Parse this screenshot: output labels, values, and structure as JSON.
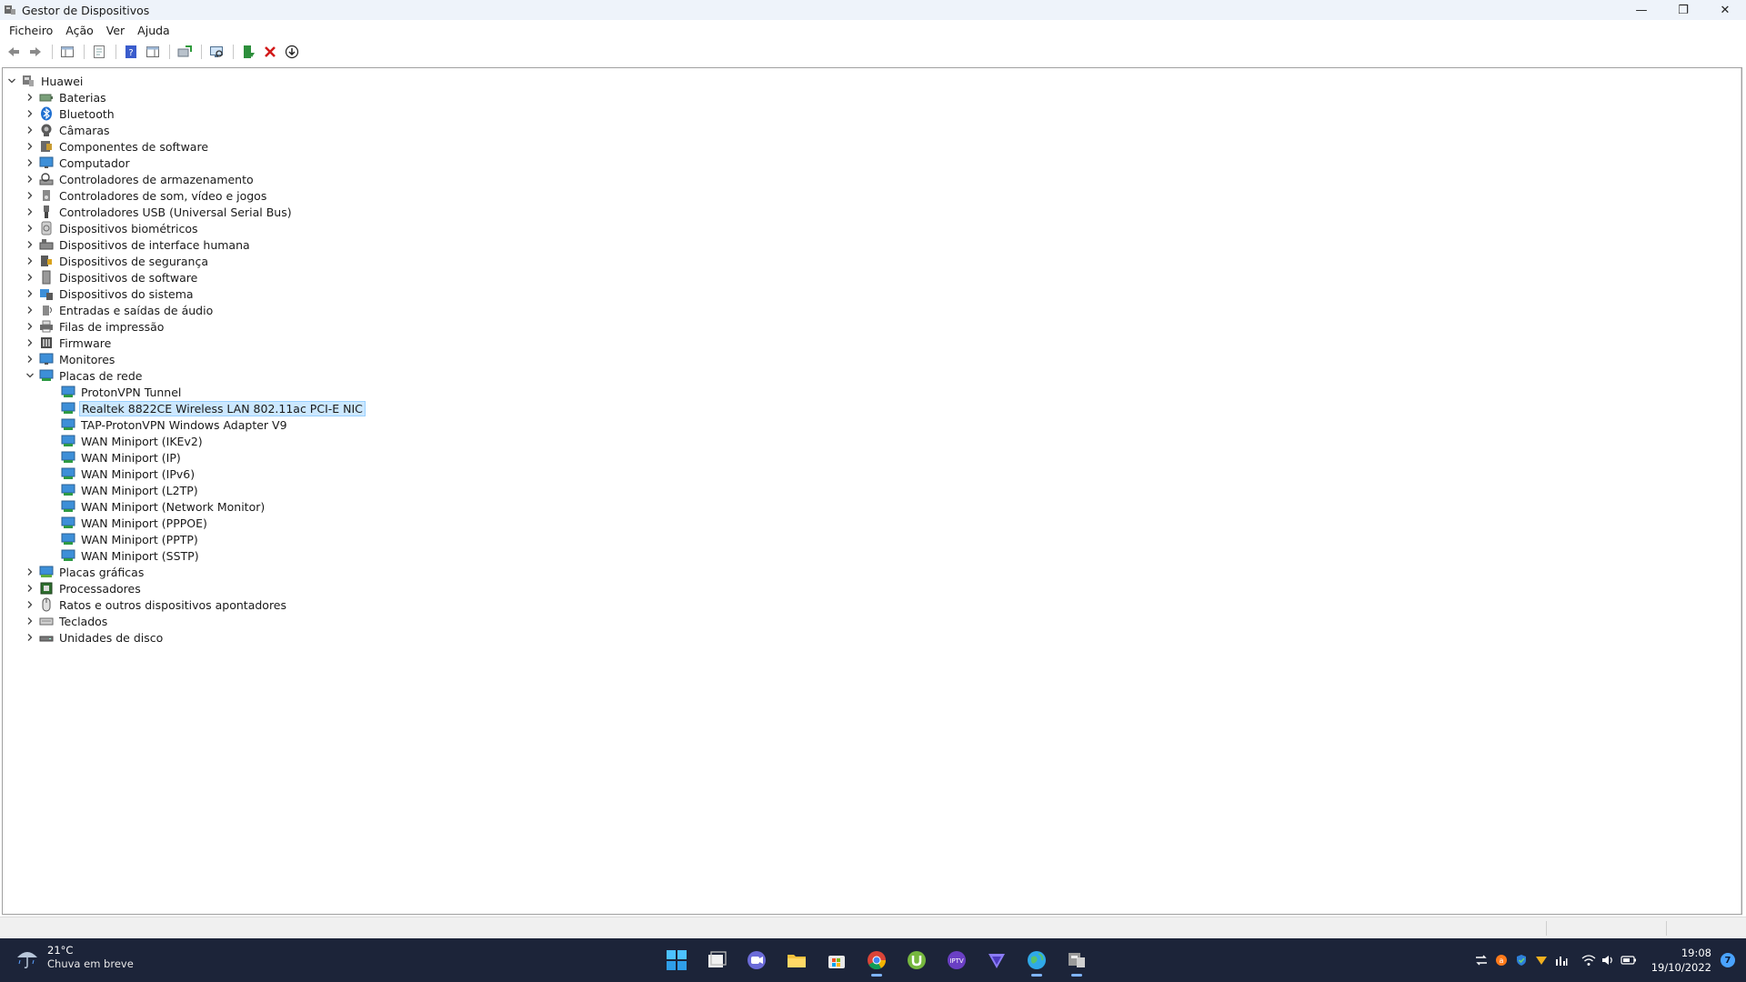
{
  "window": {
    "title": "Gestor de Dispositivos",
    "controls": {
      "minimize": "—",
      "restore": "❐",
      "close": "✕"
    }
  },
  "menu": [
    "Ficheiro",
    "Ação",
    "Ver",
    "Ajuda"
  ],
  "toolbar_icons": [
    "back-arrow-icon",
    "forward-arrow-icon",
    "show-hide-console-tree-icon",
    "properties-icon",
    "help-icon",
    "action-pane-icon",
    "update-driver-icon",
    "scan-hardware-icon",
    "enable-device-icon",
    "uninstall-device-icon",
    "download-driver-icon"
  ],
  "tree": {
    "root": {
      "label": "Huawei",
      "icon": "computer-icon"
    },
    "categories": [
      {
        "label": "Baterias",
        "icon": "battery-icon"
      },
      {
        "label": "Bluetooth",
        "icon": "bluetooth-icon"
      },
      {
        "label": "Câmaras",
        "icon": "camera-icon"
      },
      {
        "label": "Componentes de software",
        "icon": "software-component-icon"
      },
      {
        "label": "Computador",
        "icon": "monitor-icon"
      },
      {
        "label": "Controladores de armazenamento",
        "icon": "storage-controller-icon"
      },
      {
        "label": "Controladores de som, vídeo e jogos",
        "icon": "speaker-icon"
      },
      {
        "label": "Controladores USB (Universal Serial Bus)",
        "icon": "usb-icon"
      },
      {
        "label": "Dispositivos biométricos",
        "icon": "fingerprint-icon"
      },
      {
        "label": "Dispositivos de interface humana",
        "icon": "hid-icon"
      },
      {
        "label": "Dispositivos de segurança",
        "icon": "security-key-icon"
      },
      {
        "label": "Dispositivos de software",
        "icon": "software-device-icon"
      },
      {
        "label": "Dispositivos do sistema",
        "icon": "system-folder-icon"
      },
      {
        "label": "Entradas e saídas de áudio",
        "icon": "audio-io-icon"
      },
      {
        "label": "Filas de impressão",
        "icon": "printer-icon"
      },
      {
        "label": "Firmware",
        "icon": "firmware-icon"
      },
      {
        "label": "Monitores",
        "icon": "monitor-icon"
      },
      {
        "label": "Placas de rede",
        "icon": "network-adapter-icon",
        "expanded": true,
        "children": [
          "ProtonVPN Tunnel",
          "Realtek 8822CE Wireless LAN 802.11ac PCI-E NIC",
          "TAP-ProtonVPN Windows Adapter V9",
          "WAN Miniport (IKEv2)",
          "WAN Miniport (IP)",
          "WAN Miniport (IPv6)",
          "WAN Miniport (L2TP)",
          "WAN Miniport (Network Monitor)",
          "WAN Miniport (PPPOE)",
          "WAN Miniport (PPTP)",
          "WAN Miniport (SSTP)"
        ],
        "selected_child": 1
      },
      {
        "label": "Placas gráficas",
        "icon": "display-adapter-icon"
      },
      {
        "label": "Processadores",
        "icon": "processor-icon"
      },
      {
        "label": "Ratos e outros dispositivos apontadores",
        "icon": "mouse-icon"
      },
      {
        "label": "Teclados",
        "icon": "keyboard-icon"
      },
      {
        "label": "Unidades de disco",
        "icon": "disk-drive-icon"
      }
    ]
  },
  "taskbar": {
    "weather": {
      "temp": "21°C",
      "condition": "Chuva em breve"
    },
    "apps": [
      "start-icon",
      "task-view-icon",
      "chat-icon",
      "file-explorer-icon",
      "store-icon",
      "chrome-icon",
      "utorrent-icon",
      "iptv-icon",
      "vpn-icon",
      "browser-globe-icon",
      "device-manager-icon"
    ],
    "tray_icons": [
      "sync-icon",
      "avast-icon",
      "defender-icon",
      "protonvpn-icon",
      "stats-icon",
      "wifi-icon",
      "volume-icon",
      "battery-icon"
    ],
    "time": "19:08",
    "date": "19/10/2022",
    "notification_count": "7"
  },
  "colors": {
    "selection": "#cce8ff",
    "taskbar": "#1c2439",
    "accent": "#0078d4"
  }
}
